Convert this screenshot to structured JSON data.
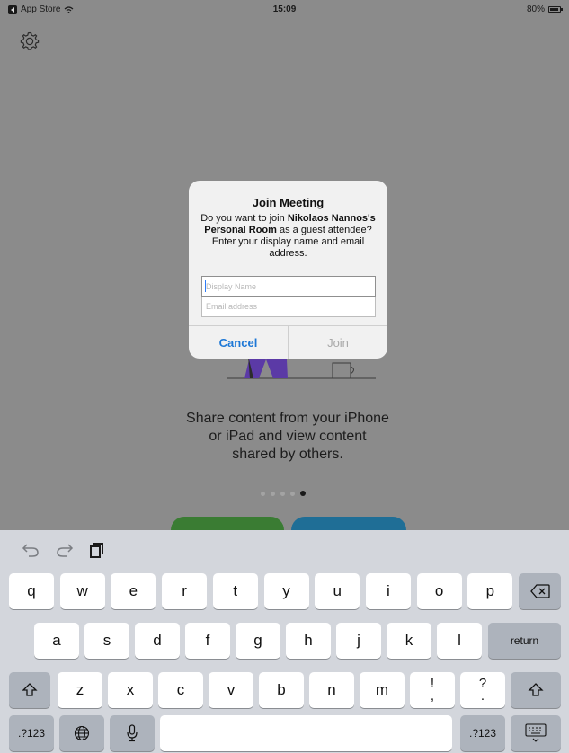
{
  "status_bar": {
    "back_app": "App Store",
    "time": "15:09",
    "battery": "80%",
    "battery_level": 0.8
  },
  "onboarding": {
    "tagline_lines": [
      "Share content from your iPhone",
      "or iPad and view content",
      "shared by others."
    ],
    "page_count": 5,
    "active_page": 4
  },
  "dialog": {
    "title": "Join Meeting",
    "message": {
      "pre": "Do you want to join ",
      "host": "Nikolaos Nannos's Personal Room",
      "post": " as a guest attendee? Enter your display name and email address."
    },
    "display_name": {
      "value": "",
      "placeholder": "Display Name"
    },
    "email": {
      "value": "",
      "placeholder": "Email address"
    },
    "cancel_label": "Cancel",
    "join_label": "Join"
  },
  "keyboard": {
    "row1": [
      "q",
      "w",
      "e",
      "r",
      "t",
      "y",
      "u",
      "i",
      "o",
      "p"
    ],
    "row2": [
      "a",
      "s",
      "d",
      "f",
      "g",
      "h",
      "j",
      "k",
      "l"
    ],
    "row3": [
      "z",
      "x",
      "c",
      "v",
      "b",
      "n",
      "m"
    ],
    "return_label": "return",
    "numbers_label": ".?123",
    "punct1": [
      "!",
      ","
    ],
    "punct2": [
      "?",
      "."
    ]
  },
  "icons": {
    "settings": "gear-icon",
    "undo": "undo-icon",
    "redo": "redo-icon",
    "paste": "paste-icon",
    "backspace": "backspace-icon",
    "shift": "shift-icon",
    "globe": "globe-icon",
    "mic": "microphone-icon",
    "hide_keyboard": "keyboard-dismiss-icon"
  }
}
